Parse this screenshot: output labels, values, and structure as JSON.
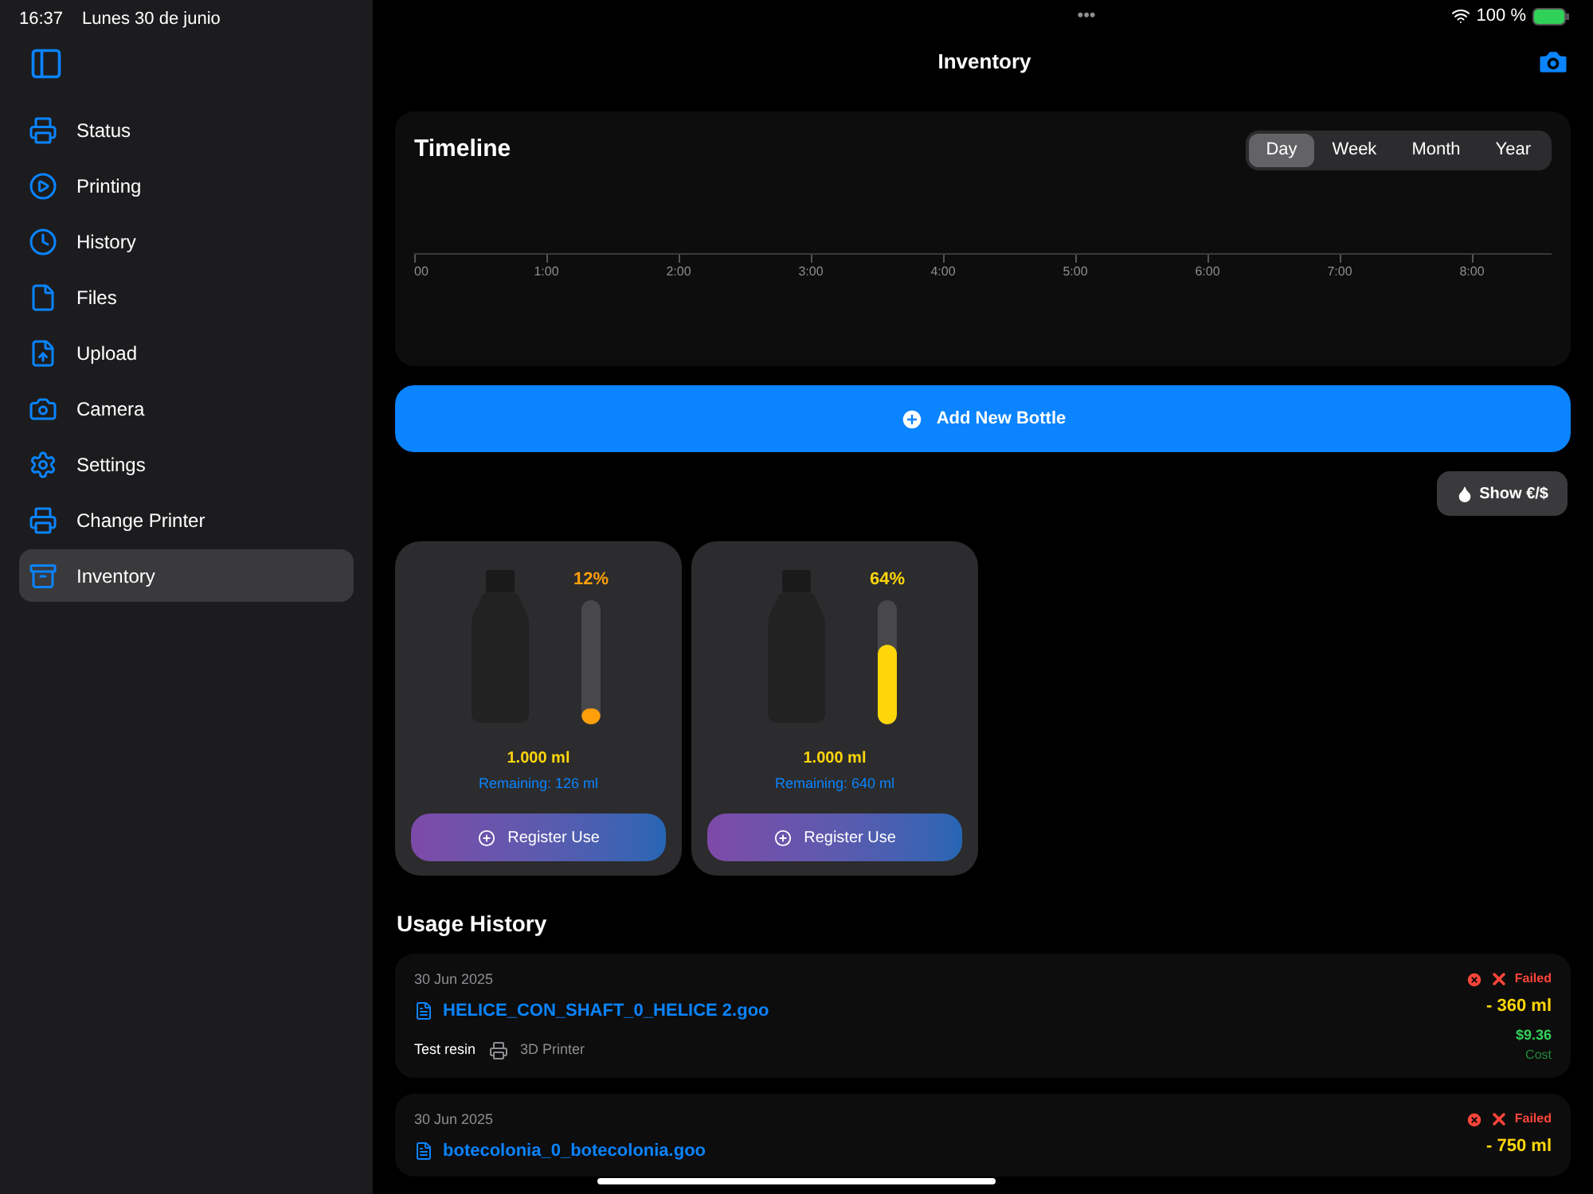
{
  "status_bar": {
    "time": "16:37",
    "date": "Lunes 30 de junio",
    "dots": "•••",
    "battery": "100 %"
  },
  "sidebar": {
    "items": [
      {
        "label": "Status",
        "selected": false
      },
      {
        "label": "Printing",
        "selected": false
      },
      {
        "label": "History",
        "selected": false
      },
      {
        "label": "Files",
        "selected": false
      },
      {
        "label": "Upload",
        "selected": false
      },
      {
        "label": "Camera",
        "selected": false
      },
      {
        "label": "Settings",
        "selected": false
      },
      {
        "label": "Change Printer",
        "selected": false
      },
      {
        "label": "Inventory",
        "selected": true
      }
    ]
  },
  "nav": {
    "title": "Inventory"
  },
  "timeline": {
    "title": "Timeline",
    "ranges": [
      {
        "label": "Day",
        "selected": true
      },
      {
        "label": "Week",
        "selected": false
      },
      {
        "label": "Month",
        "selected": false
      },
      {
        "label": "Year",
        "selected": false
      }
    ],
    "axis_labels": [
      "00",
      "1:00",
      "2:00",
      "3:00",
      "4:00",
      "5:00",
      "6:00",
      "7:00",
      "8:00"
    ]
  },
  "add_button": "Add New Bottle",
  "currency_button": "Show €/$",
  "bottles": [
    {
      "percent": "12%",
      "level": 0.12,
      "color": "#ff9f0a",
      "volume": "1.000 ml",
      "remaining": "Remaining: 126 ml",
      "button": "Register Use"
    },
    {
      "percent": "64%",
      "level": 0.64,
      "color": "#ffd60a",
      "volume": "1.000 ml",
      "remaining": "Remaining: 640 ml",
      "button": "Register Use"
    }
  ],
  "usage_history": {
    "title": "Usage History",
    "entries": [
      {
        "date": "30 Jun 2025",
        "file": "HELICE_CON_SHAFT_0_HELICE 2.goo",
        "status": "Failed",
        "amount": "- 360 ml",
        "resin": "Test resin",
        "printer": "3D Printer",
        "cost": "$9.36",
        "cost_label": "Cost"
      },
      {
        "date": "30 Jun 2025",
        "file": "botecolonia_0_botecolonia.goo",
        "status": "Failed",
        "amount": "- 750 ml"
      }
    ]
  }
}
